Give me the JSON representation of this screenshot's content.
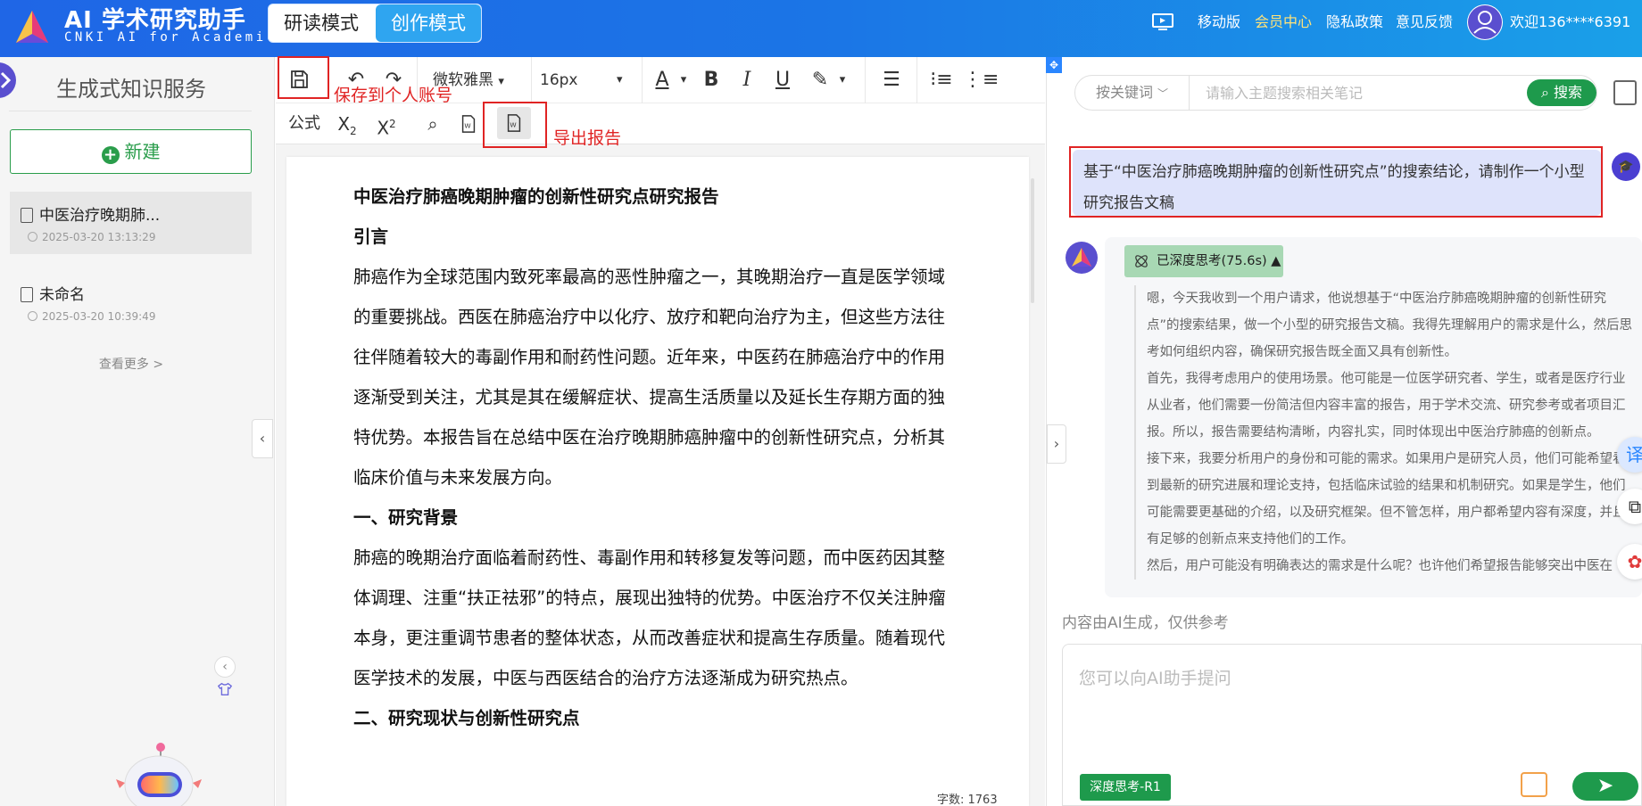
{
  "header": {
    "app_title": "AI 学术研究助手",
    "app_subtitle": "CNKI AI for Academic",
    "modes": [
      "研读模式",
      "创作模式"
    ],
    "nav": [
      "移动版",
      "会员中心",
      "隐私政策",
      "意见反馈"
    ],
    "user": "欢迎136****6391 ▾",
    "colors": {
      "brand": "#1f6fe6",
      "accent_green": "#1e9a4c",
      "annotation_red": "#e02424"
    }
  },
  "sidebar": {
    "title": "生成式知识服务",
    "new_button": "新建",
    "docs": [
      {
        "name": "中医治疗晚期肺...",
        "time": "2025-03-20 13:13:29"
      },
      {
        "name": "未命名",
        "time": "2025-03-20 10:39:49"
      }
    ],
    "more": "查看更多 >"
  },
  "toolbar": {
    "font_family": "微软雅黑",
    "font_size": "16px",
    "formula": "公式",
    "save_annotation": "保存到个人账号",
    "export_annotation": "导出报告",
    "icons": [
      "save-icon",
      "undo-icon",
      "redo-icon",
      "font-color-icon",
      "bold-icon",
      "italic-icon",
      "underline-icon",
      "highlight-icon",
      "align-left-icon",
      "bullet-list-icon",
      "numbered-list-icon",
      "subscript-icon",
      "superscript-icon",
      "search-icon",
      "word-import-icon",
      "export-word-icon"
    ]
  },
  "document": {
    "title": "中医治疗肺癌晚期肿瘤的创新性研究点研究报告",
    "h_intro": "引言",
    "p_intro": "肺癌作为全球范围内致死率最高的恶性肿瘤之一，其晚期治疗一直是医学领域的重要挑战。西医在肺癌治疗中以化疗、放疗和靶向治疗为主，但这些方法往往伴随着较大的毒副作用和耐药性问题。近年来，中医药在肺癌治疗中的作用逐渐受到关注，尤其是其在缓解症状、提高生活质量以及延长生存期方面的独特优势。本报告旨在总结中医在治疗晚期肺癌肿瘤中的创新性研究点，分析其临床价值与未来发展方向。",
    "h_bg": "一、研究背景",
    "p_bg": "肺癌的晚期治疗面临着耐药性、毒副作用和转移复发等问题，而中医药因其整体调理、注重“扶正祛邪”的特点，展现出独特的优势。中医治疗不仅关注肿瘤本身，更注重调节患者的整体状态，从而改善症状和提高生存质量。随着现代医学技术的发展，中医与西医结合的治疗方法逐渐成为研究热点。",
    "h_status": "二、研究现状与创新性研究点",
    "word_count": "字数: 1763"
  },
  "assistant": {
    "search_keyword": "按关键词",
    "search_placeholder": "请输入主题搜索相关笔记",
    "search_button": "搜索",
    "user_message": "基于“中医治疗肺癌晚期肿瘤的创新性研究点”的搜索结论，请制作一个小型研究报告文稿",
    "think_tag": "已深度思考(75.6s) ▲",
    "think_paragraphs": [
      "嗯，今天我收到一个用户请求，他说想基于“中医治疗肺癌晚期肿瘤的创新性研究点”的搜索结果，做一个小型的研究报告文稿。我得先理解用户的需求是什么，然后思考如何组织内容，确保研究报告既全面又具有创新性。",
      "首先，我得考虑用户的使用场景。他可能是一位医学研究者、学生，或者是医疗行业从业者，他们需要一份简洁但内容丰富的报告，用于学术交流、研究参考或者项目汇报。所以，报告需要结构清晰，内容扎实，同时体现出中医治疗肺癌的创新点。",
      "接下来，我要分析用户的身份和可能的需求。如果用户是研究人员，他们可能希望看到最新的研究进展和理论支持，包括临床试验的结果和机制研究。如果是学生，他们可能需要更基础的介绍，以及研究框架。但不管怎样，用户都希望内容有深度，并且有足够的创新点来支持他们的工作。",
      "然后，用户可能没有明确表达的需求是什么呢？也许他们希望报告能够突出中医在"
    ],
    "disclaimer": "内容由AI生成，仅供参考",
    "ask_placeholder": "您可以向AI助手提问",
    "deep_think_tag": "深度思考-R1",
    "side_icons": [
      "translate-icon",
      "cube-icon",
      "app-icon"
    ]
  }
}
